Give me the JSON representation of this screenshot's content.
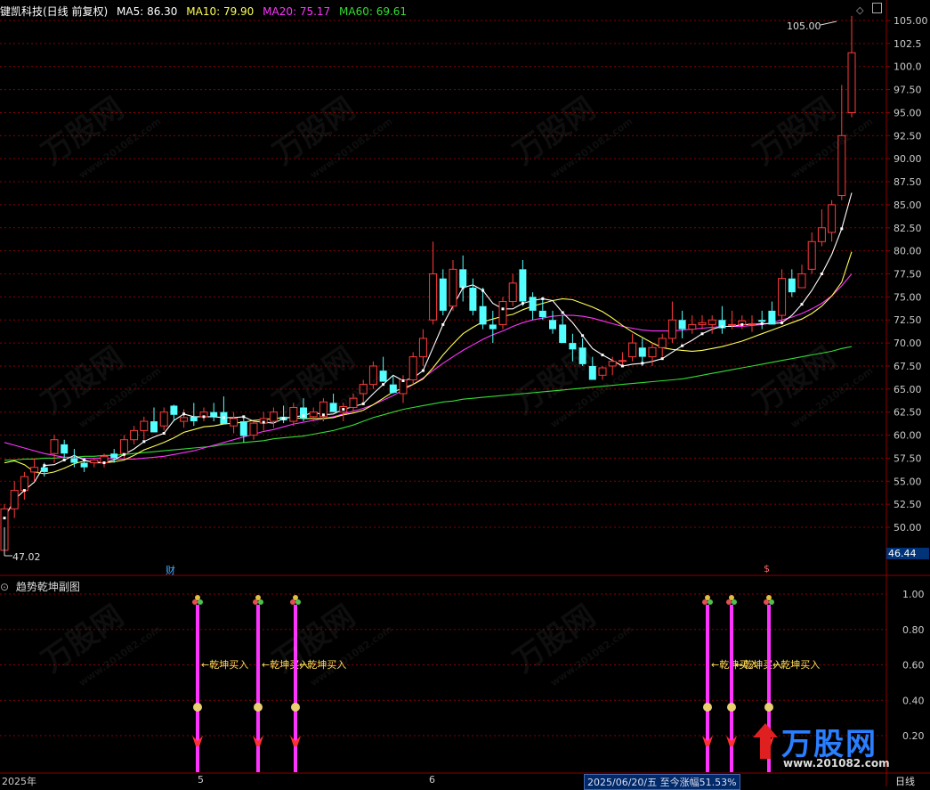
{
  "header": {
    "stock": "键凯科技(日线 前复权)",
    "ma5": "MA5: 86.30",
    "ma10": "MA10: 79.90",
    "ma20": "MA20: 75.17",
    "ma60": "MA60: 69.61"
  },
  "subchart": {
    "title": "趋势乾坤副图",
    "signal_label": "←乾坤买入",
    "signals": [
      {
        "label": "←乾坤买入"
      },
      {
        "label": "←乾坤买入"
      },
      {
        "label": "←乾坤买入"
      },
      {
        "label": "←乾坤买入"
      },
      {
        "label": "←乾坤买入"
      },
      {
        "label": "←乾坤买入"
      }
    ],
    "y_ticks": [
      "1.00",
      "0.80",
      "0.60",
      "0.40",
      "0.20"
    ]
  },
  "markers": {
    "high": "105.00",
    "low": "47.02",
    "cai": "财",
    "s_mark": "$",
    "current": "46.44"
  },
  "bottom": {
    "year": "2025年",
    "m5": "5",
    "m6": "6",
    "status": "2025/06/20/五  至今涨幅51.53%",
    "period": "日线"
  },
  "watermark": {
    "text": "万股网",
    "site": "www.201082.com",
    "brand": "万股网",
    "brand_site": "www.201082.com"
  },
  "colors": {
    "up": "#ff3b3b",
    "down": "#54ffff",
    "ma5": "#ffffff",
    "ma10": "#ffff55",
    "ma20": "#ff33ff",
    "ma60": "#33dd33",
    "grid": "#8b0000",
    "signal": "#ff33ff"
  },
  "chart_data": {
    "type": "candlestick",
    "y_ticks": [
      "105.00",
      "102.5",
      "100.0",
      "97.50",
      "95.00",
      "92.50",
      "90.00",
      "87.50",
      "85.00",
      "82.50",
      "80.00",
      "77.50",
      "75.00",
      "72.50",
      "70.00",
      "67.50",
      "65.00",
      "62.50",
      "60.00",
      "57.50",
      "55.00",
      "52.50",
      "50.00"
    ],
    "ylim": [
      47.0,
      106.5
    ],
    "candles": [
      [
        47.5,
        52.5,
        47.0,
        52.0
      ],
      [
        52,
        55,
        51,
        54
      ],
      [
        54,
        56,
        53,
        55.5
      ],
      [
        56,
        57.5,
        55,
        56.5
      ],
      [
        56.5,
        57,
        55.5,
        56
      ],
      [
        58,
        60,
        57,
        59.5
      ],
      [
        59,
        59.5,
        57.5,
        58
      ],
      [
        57.5,
        58.5,
        56.5,
        57
      ],
      [
        57,
        57.5,
        56,
        56.5
      ],
      [
        57,
        57.5,
        56.5,
        57.3
      ],
      [
        57,
        58,
        56.5,
        57.7
      ],
      [
        58,
        58.5,
        57,
        57.5
      ],
      [
        58,
        60,
        57.5,
        59.5
      ],
      [
        59.5,
        61,
        59,
        60.5
      ],
      [
        60.5,
        62,
        59.5,
        61.5
      ],
      [
        61.5,
        63,
        60.5,
        60.3
      ],
      [
        61,
        63,
        60.5,
        62.5
      ],
      [
        63.2,
        63.3,
        61.5,
        62.2
      ],
      [
        61.5,
        62.8,
        60.8,
        61.9
      ],
      [
        62,
        63.5,
        61,
        61.5
      ],
      [
        62,
        63,
        61.5,
        62.5
      ],
      [
        62.5,
        63.5,
        61.5,
        62
      ],
      [
        62.5,
        64.2,
        61.5,
        61.2
      ],
      [
        61,
        62.5,
        60.2,
        61.8
      ],
      [
        61.5,
        62,
        59.2,
        59.9
      ],
      [
        60,
        61.5,
        59.5,
        61.3
      ],
      [
        61.3,
        62.5,
        60.5,
        61.8
      ],
      [
        61.5,
        63,
        60.8,
        62.5
      ],
      [
        62,
        63.2,
        61.3,
        61.6
      ],
      [
        61.5,
        63.5,
        61,
        63
      ],
      [
        63,
        64,
        61.5,
        61.8
      ],
      [
        62,
        63,
        61.5,
        62.5
      ],
      [
        62,
        64,
        61.5,
        63.6
      ],
      [
        63.5,
        64.5,
        62.8,
        62.5
      ],
      [
        62.5,
        63.5,
        61.5,
        63.1
      ],
      [
        63,
        64.5,
        62.5,
        64
      ],
      [
        64.5,
        66,
        63.5,
        65.5
      ],
      [
        65.5,
        68,
        65,
        67.5
      ],
      [
        67,
        68.5,
        66,
        65.8
      ],
      [
        65.5,
        66.5,
        64.5,
        64.6
      ],
      [
        64.5,
        66.5,
        63.5,
        66
      ],
      [
        66,
        69,
        65.5,
        68.5
      ],
      [
        68.5,
        71.5,
        67.5,
        70.5
      ],
      [
        72.5,
        81,
        72,
        77.5
      ],
      [
        77,
        78,
        73,
        73.5
      ],
      [
        74,
        79,
        73.5,
        78
      ],
      [
        78,
        79.5,
        74.5,
        76
      ],
      [
        76,
        77,
        73,
        73.5
      ],
      [
        74,
        76,
        71.5,
        72
      ],
      [
        72,
        73.5,
        70,
        71.5
      ],
      [
        72,
        75,
        71.5,
        74.5
      ],
      [
        74.5,
        77.5,
        74,
        76.5
      ],
      [
        78,
        79,
        74,
        74.5
      ],
      [
        75,
        75.5,
        72.5,
        73.5
      ],
      [
        73.5,
        75,
        72.5,
        72.8
      ],
      [
        72.5,
        73.5,
        71,
        71.5
      ],
      [
        72,
        73,
        70,
        70
      ],
      [
        70,
        71,
        68,
        69.3
      ],
      [
        69.5,
        70.5,
        67.5,
        67.7
      ],
      [
        67.5,
        68.5,
        66,
        66
      ],
      [
        66.5,
        67.5,
        66,
        67.3
      ],
      [
        67.5,
        68.5,
        66.5,
        68
      ],
      [
        68,
        69,
        67.5,
        68.1
      ],
      [
        68.5,
        71,
        68,
        70
      ],
      [
        69.5,
        70.5,
        67.5,
        68.5
      ],
      [
        68.5,
        70,
        67.5,
        69.5
      ],
      [
        69.5,
        71,
        68.5,
        70.5
      ],
      [
        70.5,
        74.5,
        70,
        72.5
      ],
      [
        72.5,
        73.5,
        70.5,
        71.5
      ],
      [
        71.5,
        73,
        71,
        72
      ],
      [
        72,
        73,
        71.5,
        72.2
      ],
      [
        72,
        73,
        71,
        72.5
      ],
      [
        72.5,
        74,
        71,
        71.6
      ],
      [
        72,
        73.5,
        71.5,
        72
      ],
      [
        72,
        73,
        71.5,
        72.4
      ],
      [
        72,
        73,
        71.2,
        72.1
      ],
      [
        72.5,
        73.5,
        71.5,
        72.3
      ],
      [
        73.5,
        74.5,
        72.5,
        72
      ],
      [
        73,
        78,
        72,
        77
      ],
      [
        77,
        78,
        75,
        75.5
      ],
      [
        76,
        78.5,
        76,
        77.5
      ],
      [
        78,
        82,
        77.5,
        81
      ],
      [
        81,
        84.5,
        80.5,
        82.5
      ],
      [
        82,
        85.5,
        81,
        85
      ],
      [
        86,
        98,
        85.5,
        92.5
      ],
      [
        95,
        105.5,
        94.5,
        101.5
      ]
    ],
    "ma5": [
      51.0,
      53.0,
      54.0,
      54.9,
      56.7,
      56.8,
      57.3,
      57.8,
      57.3,
      57.0,
      57.0,
      57.3,
      57.9,
      58.5,
      59.3,
      59.8,
      60.2,
      61.6,
      62.3,
      62.0,
      62.0,
      62.0,
      61.9,
      61.9,
      62.0,
      61.5,
      61.4,
      61.3,
      61.8,
      62.0,
      62.1,
      62.5,
      62.2,
      62.3,
      62.8,
      63.1,
      63.4,
      64.5,
      65.5,
      66.5,
      65.9,
      66.2,
      67.0,
      69.5,
      72.0,
      74.0,
      76.0,
      76.3,
      75.7,
      74.3,
      73.7,
      73.7,
      74.3,
      74.6,
      74.8,
      74.6,
      73.3,
      72.2,
      70.8,
      69.4,
      68.7,
      68.1,
      67.5,
      67.7,
      67.8,
      68.0,
      68.3,
      69.0,
      69.7,
      70.3,
      71.0,
      71.5,
      71.8,
      71.8,
      72.0,
      72.0,
      72.1,
      72.1,
      72.2,
      73.0,
      74.2,
      75.7,
      77.5,
      79.6,
      82.4,
      86.3
    ],
    "ma10": [
      57.0,
      57.2,
      56.8,
      56.0,
      55.8,
      56.0,
      56.4,
      56.9,
      57.2,
      57.1,
      57.0,
      57.1,
      57.3,
      57.8,
      58.4,
      58.8,
      59.2,
      59.7,
      60.3,
      60.6,
      60.9,
      61.0,
      61.2,
      61.3,
      61.4,
      61.6,
      61.7,
      61.8,
      61.9,
      61.9,
      61.8,
      61.8,
      61.8,
      61.9,
      62.2,
      62.4,
      62.7,
      63.3,
      64.0,
      64.7,
      65.1,
      65.5,
      66.1,
      67.3,
      68.7,
      69.9,
      71.0,
      71.7,
      72.3,
      72.6,
      72.9,
      73.1,
      73.6,
      74.0,
      74.3,
      74.6,
      74.8,
      74.7,
      74.3,
      73.9,
      73.4,
      72.7,
      71.9,
      71.2,
      70.6,
      70.0,
      69.5,
      69.3,
      69.2,
      69.1,
      69.2,
      69.4,
      69.6,
      69.9,
      70.2,
      70.6,
      71.0,
      71.4,
      71.8,
      72.2,
      72.6,
      73.2,
      74.0,
      75.1,
      76.6,
      79.9
    ],
    "ma20": [
      59.2,
      58.9,
      58.6,
      58.3,
      58.0,
      57.8,
      57.6,
      57.6,
      57.5,
      57.5,
      57.5,
      57.4,
      57.4,
      57.4,
      57.5,
      57.6,
      57.7,
      57.9,
      58.1,
      58.3,
      58.6,
      58.9,
      59.2,
      59.5,
      59.8,
      60.1,
      60.4,
      60.6,
      60.9,
      61.2,
      61.4,
      61.6,
      61.8,
      62.0,
      62.3,
      62.6,
      62.9,
      63.3,
      63.8,
      64.3,
      64.9,
      65.5,
      66.2,
      67.0,
      67.8,
      68.5,
      69.2,
      69.8,
      70.4,
      70.9,
      71.3,
      71.8,
      72.2,
      72.5,
      72.7,
      72.9,
      73.0,
      73.0,
      72.9,
      72.7,
      72.4,
      72.1,
      71.8,
      71.6,
      71.4,
      71.3,
      71.3,
      71.3,
      71.4,
      71.5,
      71.6,
      71.7,
      71.8,
      71.8,
      71.8,
      71.9,
      72.0,
      72.2,
      72.5,
      72.8,
      73.2,
      73.7,
      74.3,
      75.1,
      76.2,
      77.5
    ],
    "ma60": [
      57.3,
      57.3,
      57.4,
      57.4,
      57.5,
      57.5,
      57.6,
      57.6,
      57.7,
      57.7,
      57.8,
      57.8,
      57.9,
      58.0,
      58.1,
      58.2,
      58.3,
      58.4,
      58.5,
      58.6,
      58.7,
      58.8,
      59.0,
      59.1,
      59.2,
      59.3,
      59.4,
      59.6,
      59.7,
      59.8,
      59.9,
      60.1,
      60.3,
      60.5,
      60.8,
      61.1,
      61.5,
      61.9,
      62.2,
      62.5,
      62.8,
      63.0,
      63.2,
      63.4,
      63.6,
      63.7,
      63.9,
      64.0,
      64.1,
      64.2,
      64.3,
      64.4,
      64.5,
      64.6,
      64.7,
      64.8,
      64.9,
      65.0,
      65.1,
      65.2,
      65.3,
      65.4,
      65.5,
      65.6,
      65.7,
      65.8,
      65.9,
      66.0,
      66.1,
      66.3,
      66.5,
      66.7,
      66.9,
      67.1,
      67.3,
      67.5,
      67.7,
      67.9,
      68.1,
      68.3,
      68.5,
      68.7,
      68.9,
      69.1,
      69.4,
      69.6
    ]
  }
}
